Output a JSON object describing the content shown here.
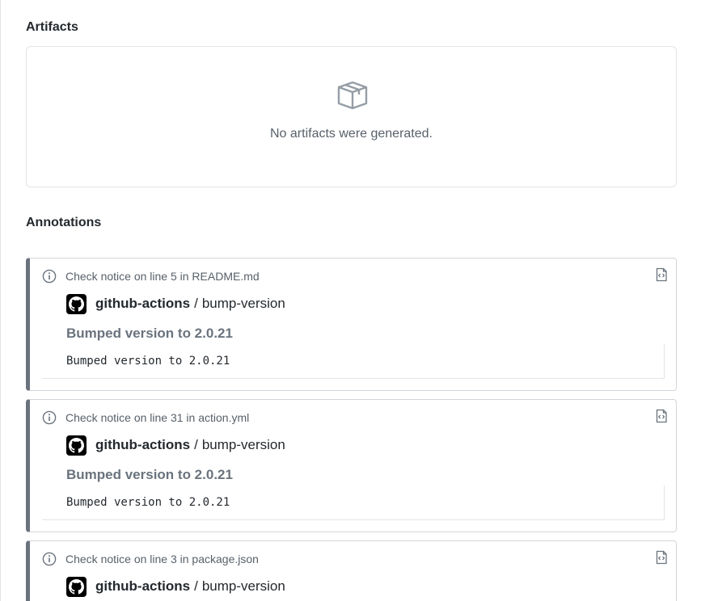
{
  "artifacts": {
    "title": "Artifacts",
    "empty_icon": "package-icon",
    "empty_message": "No artifacts were generated."
  },
  "annotations": {
    "title": "Annotations",
    "colors": {
      "notice_border": "#6a737d",
      "muted_text": "#586069",
      "title_text": "#6a737d"
    },
    "items": [
      {
        "location": "Check notice on line 5 in README.md",
        "app": "github-actions",
        "separator": "/",
        "job": "bump-version",
        "title": "Bumped version to 2.0.21",
        "message": "Bumped version to 2.0.21",
        "icon": "info-icon",
        "action_icon": "file-code-icon"
      },
      {
        "location": "Check notice on line 31 in action.yml",
        "app": "github-actions",
        "separator": "/",
        "job": "bump-version",
        "title": "Bumped version to 2.0.21",
        "message": "Bumped version to 2.0.21",
        "icon": "info-icon",
        "action_icon": "file-code-icon"
      },
      {
        "location": "Check notice on line 3 in package.json",
        "app": "github-actions",
        "separator": "/",
        "job": "bump-version",
        "icon": "info-icon",
        "action_icon": "file-code-icon"
      }
    ]
  }
}
